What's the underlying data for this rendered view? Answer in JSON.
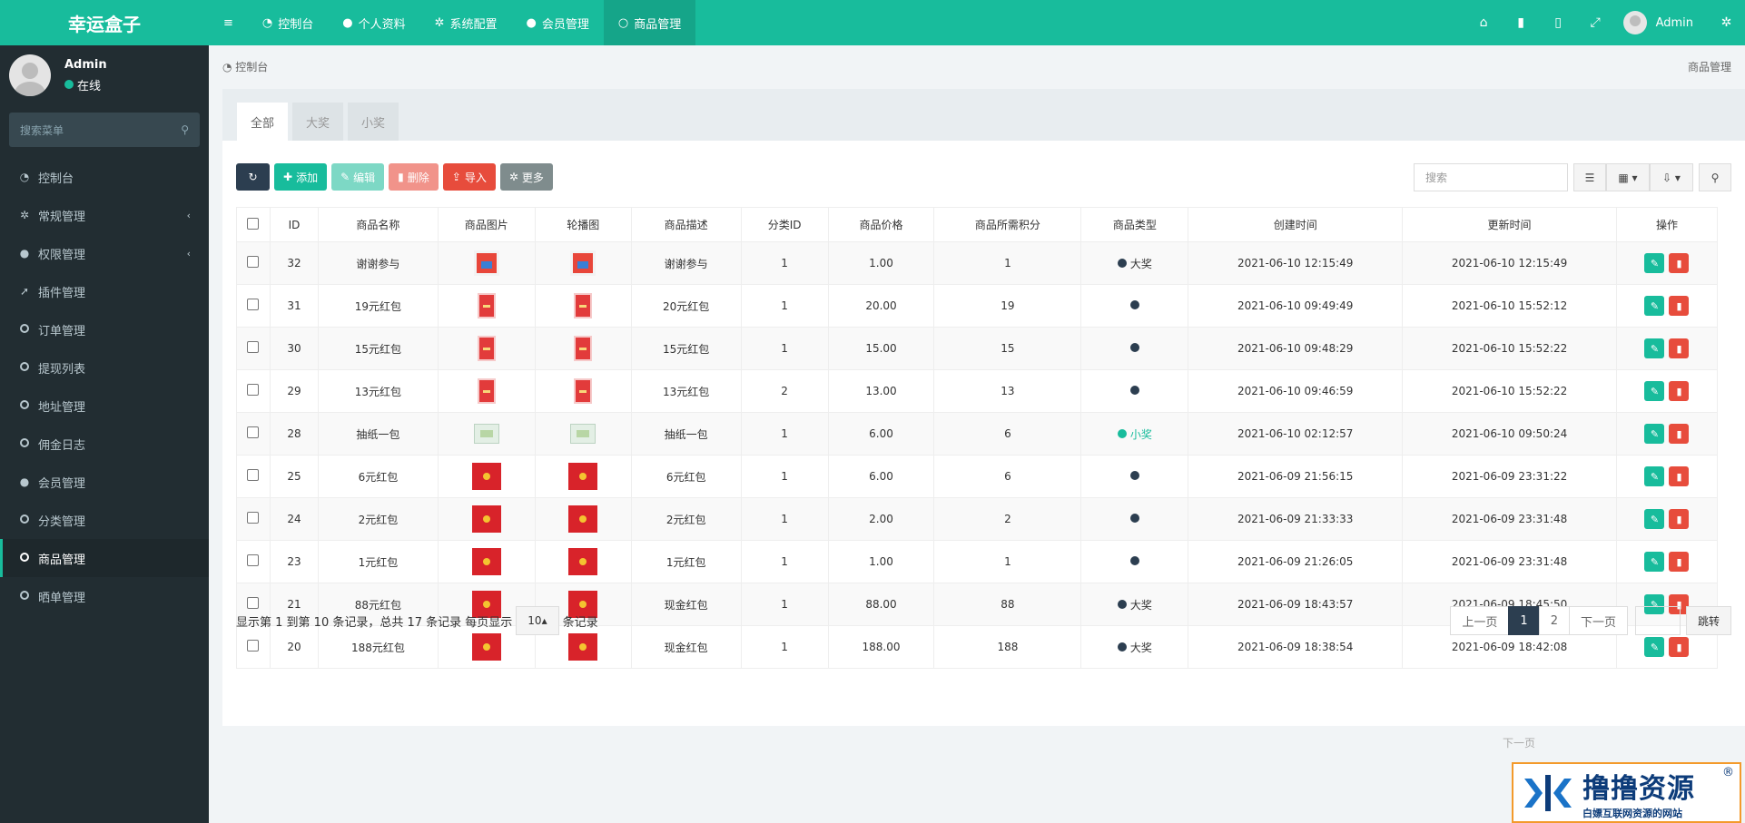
{
  "app": {
    "logo": "幸运盒子"
  },
  "topnav": {
    "items": [
      {
        "icon": "menu-icon",
        "label": ""
      },
      {
        "icon": "dashboard-icon",
        "label": "控制台"
      },
      {
        "icon": "user-icon",
        "label": "个人资料"
      },
      {
        "icon": "gear-icon",
        "label": "系统配置"
      },
      {
        "icon": "user-icon",
        "label": "会员管理"
      },
      {
        "icon": "circle-icon",
        "label": "商品管理"
      }
    ],
    "user": "Admin"
  },
  "sidebar": {
    "profile": {
      "name": "Admin",
      "status": "在线"
    },
    "search_placeholder": "搜索菜单",
    "items": [
      {
        "label": "控制台"
      },
      {
        "label": "常规管理"
      },
      {
        "label": "权限管理"
      },
      {
        "label": "插件管理"
      },
      {
        "label": "订单管理"
      },
      {
        "label": "提现列表"
      },
      {
        "label": "地址管理"
      },
      {
        "label": "佣金日志"
      },
      {
        "label": "会员管理"
      },
      {
        "label": "分类管理"
      },
      {
        "label": "商品管理"
      },
      {
        "label": "晒单管理"
      }
    ]
  },
  "breadcrumb": {
    "home": "控制台",
    "current": "商品管理"
  },
  "tabs": [
    "全部",
    "大奖",
    "小奖"
  ],
  "toolbar": {
    "add": "添加",
    "edit": "编辑",
    "delete": "删除",
    "import": "导入",
    "more": "更多"
  },
  "search": {
    "placeholder": "搜索"
  },
  "table": {
    "headers": [
      "ID",
      "商品名称",
      "商品图片",
      "轮播图",
      "商品描述",
      "分类ID",
      "商品价格",
      "商品所需积分",
      "商品类型",
      "创建时间",
      "更新时间",
      "操作"
    ],
    "rows": [
      {
        "id": "32",
        "name": "谢谢参与",
        "desc": "谢谢参与",
        "cat": "1",
        "price": "1.00",
        "points": "1",
        "type": "大奖",
        "created": "2021-06-10 12:15:49",
        "updated": "2021-06-10 12:15:49"
      },
      {
        "id": "31",
        "name": "19元红包",
        "desc": "20元红包",
        "cat": "1",
        "price": "20.00",
        "points": "19",
        "type": "",
        "created": "2021-06-10 09:49:49",
        "updated": "2021-06-10 15:52:12"
      },
      {
        "id": "30",
        "name": "15元红包",
        "desc": "15元红包",
        "cat": "1",
        "price": "15.00",
        "points": "15",
        "type": "",
        "created": "2021-06-10 09:48:29",
        "updated": "2021-06-10 15:52:22"
      },
      {
        "id": "29",
        "name": "13元红包",
        "desc": "13元红包",
        "cat": "2",
        "price": "13.00",
        "points": "13",
        "type": "",
        "created": "2021-06-10 09:46:59",
        "updated": "2021-06-10 15:52:22"
      },
      {
        "id": "28",
        "name": "抽纸一包",
        "desc": "抽纸一包",
        "cat": "1",
        "price": "6.00",
        "points": "6",
        "type": "小奖",
        "created": "2021-06-10 02:12:57",
        "updated": "2021-06-10 09:50:24"
      },
      {
        "id": "25",
        "name": "6元红包",
        "desc": "6元红包",
        "cat": "1",
        "price": "6.00",
        "points": "6",
        "type": "",
        "created": "2021-06-09 21:56:15",
        "updated": "2021-06-09 23:31:22"
      },
      {
        "id": "24",
        "name": "2元红包",
        "desc": "2元红包",
        "cat": "1",
        "price": "2.00",
        "points": "2",
        "type": "",
        "created": "2021-06-09 21:33:33",
        "updated": "2021-06-09 23:31:48"
      },
      {
        "id": "23",
        "name": "1元红包",
        "desc": "1元红包",
        "cat": "1",
        "price": "1.00",
        "points": "1",
        "type": "",
        "created": "2021-06-09 21:26:05",
        "updated": "2021-06-09 23:31:48"
      },
      {
        "id": "21",
        "name": "88元红包",
        "desc": "现金红包",
        "cat": "1",
        "price": "88.00",
        "points": "88",
        "type": "大奖",
        "created": "2021-06-09 18:43:57",
        "updated": "2021-06-09 18:45:50"
      },
      {
        "id": "20",
        "name": "188元红包",
        "desc": "现金红包",
        "cat": "1",
        "price": "188.00",
        "points": "188",
        "type": "大奖",
        "created": "2021-06-09 18:38:54",
        "updated": "2021-06-09 18:42:08"
      }
    ]
  },
  "footer": {
    "summary_prefix": "显示第 1 到第 10 条记录，总共 17 条记录 每页显示",
    "page_size": "10",
    "summary_suffix": "条记录",
    "prev": "上一页",
    "pages": [
      "1",
      "2"
    ],
    "next": "下一页",
    "go": "跳转"
  },
  "ghost_text": "下一页",
  "watermark": {
    "title": "撸撸资源",
    "sub": "白嫖互联网资源的网站",
    "reg": "®"
  },
  "colors": {
    "brand": "#18bc9c",
    "sidebar": "#222d32",
    "danger": "#e74c3c",
    "dark": "#2c3e50"
  }
}
